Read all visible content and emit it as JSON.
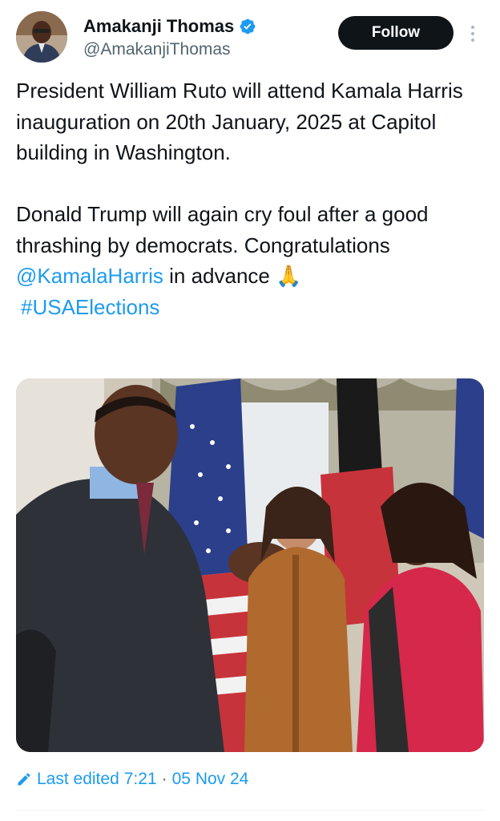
{
  "user": {
    "display_name": "Amakanji Thomas",
    "handle": "@AmakanjiThomas",
    "verified": true,
    "avatar_icon": "profile-photo"
  },
  "actions": {
    "follow_label": "Follow",
    "more_icon": "more-vertical-icon"
  },
  "tweet": {
    "para1": "President William Ruto will attend Kamala Harris inauguration on 20th January, 2025 at Capitol building in Washington.",
    "para2_text": "Donald Trump will again cry foul after a good thrashing by democrats. Congratulations",
    "mention": "@KamalaHarris",
    "para2_tail": "in advance",
    "emoji": "🙏",
    "hashtag": "#USAElections"
  },
  "media": {
    "description_icon": "photo-of-four-people-with-flags"
  },
  "footer": {
    "edited_label": "Last edited",
    "time": "7:21",
    "separator": "·",
    "date": "05 Nov 24"
  },
  "colors": {
    "accent": "#1d9bf0",
    "text": "#0f1419",
    "muted": "#536471",
    "button_bg": "#0f1419"
  }
}
